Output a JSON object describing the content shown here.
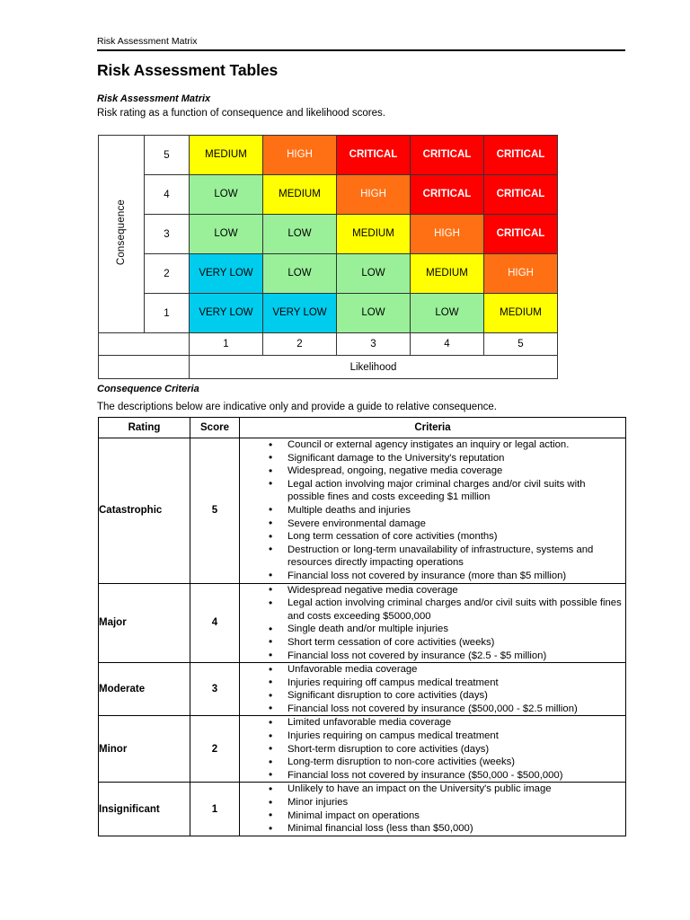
{
  "header": {
    "running_title": "Risk Assessment Matrix"
  },
  "page_title": "Risk Assessment Tables",
  "matrix_section": {
    "heading": "Risk Assessment Matrix",
    "subtitle": "Risk rating as a function of consequence and likelihood scores.",
    "axis_y_label": "Consequence",
    "axis_x_label": "Likelihood",
    "consequence_scores": [
      "5",
      "4",
      "3",
      "2",
      "1"
    ],
    "likelihood_scores": [
      "1",
      "2",
      "3",
      "4",
      "5"
    ],
    "colors": {
      "very_low": "#00CCEE",
      "low": "#99F099",
      "medium": "#FFFF00",
      "high": "#FF7014",
      "critical": "#FF0000",
      "white_text": "#FFFFFF",
      "black_text": "#000000"
    },
    "rows": [
      {
        "consequence": "5",
        "cells": [
          {
            "label": "MEDIUM",
            "level": "medium"
          },
          {
            "label": "HIGH",
            "level": "high"
          },
          {
            "label": "CRITICAL",
            "level": "critical"
          },
          {
            "label": "CRITICAL",
            "level": "critical"
          },
          {
            "label": "CRITICAL",
            "level": "critical"
          }
        ]
      },
      {
        "consequence": "4",
        "cells": [
          {
            "label": "LOW",
            "level": "low"
          },
          {
            "label": "MEDIUM",
            "level": "medium"
          },
          {
            "label": "HIGH",
            "level": "high"
          },
          {
            "label": "CRITICAL",
            "level": "critical"
          },
          {
            "label": "CRITICAL",
            "level": "critical"
          }
        ]
      },
      {
        "consequence": "3",
        "cells": [
          {
            "label": "LOW",
            "level": "low"
          },
          {
            "label": "LOW",
            "level": "low"
          },
          {
            "label": "MEDIUM",
            "level": "medium"
          },
          {
            "label": "HIGH",
            "level": "high"
          },
          {
            "label": "CRITICAL",
            "level": "critical"
          }
        ]
      },
      {
        "consequence": "2",
        "cells": [
          {
            "label": "VERY LOW",
            "level": "verylow"
          },
          {
            "label": "LOW",
            "level": "low"
          },
          {
            "label": "LOW",
            "level": "low"
          },
          {
            "label": "MEDIUM",
            "level": "medium"
          },
          {
            "label": "HIGH",
            "level": "high"
          }
        ]
      },
      {
        "consequence": "1",
        "cells": [
          {
            "label": "VERY LOW",
            "level": "verylow"
          },
          {
            "label": "VERY LOW",
            "level": "verylow"
          },
          {
            "label": "LOW",
            "level": "low"
          },
          {
            "label": "LOW",
            "level": "low"
          },
          {
            "label": "MEDIUM",
            "level": "medium"
          }
        ]
      }
    ]
  },
  "criteria_section": {
    "heading": "Consequence Criteria",
    "subtitle": "The descriptions below are indicative only and provide a guide to relative consequence.",
    "columns": [
      "Rating",
      "Score",
      "Criteria"
    ],
    "rows": [
      {
        "rating": "Catastrophic",
        "score": "5",
        "criteria": [
          "Council or external agency instigates an inquiry or legal action.",
          "Significant damage to the University's reputation",
          "Widespread, ongoing, negative media coverage",
          "Legal action involving major criminal charges and/or civil suits with possible fines and costs exceeding $1 million",
          "Multiple deaths and injuries",
          "Severe environmental damage",
          "Long term cessation of core activities (months)",
          "Destruction or long-term unavailability of infrastructure, systems and resources directly impacting operations",
          "Financial loss not covered by insurance  (more than $5 million)"
        ]
      },
      {
        "rating": "Major",
        "score": "4",
        "criteria": [
          "Widespread negative media coverage",
          "Legal action involving criminal charges and/or civil suits with possible fines and costs exceeding $5000,000",
          "Single death and/or multiple injuries",
          "Short term cessation of core activities (weeks)",
          "Financial loss not covered by insurance ($2.5 - $5 million)"
        ]
      },
      {
        "rating": "Moderate",
        "score": "3",
        "criteria": [
          "Unfavorable media coverage",
          "Injuries requiring off campus medical treatment",
          "Significant disruption to core activities (days)",
          "Financial loss not covered by insurance ($500,000 - $2.5 million)"
        ]
      },
      {
        "rating": "Minor",
        "score": "2",
        "criteria": [
          "Limited unfavorable media coverage",
          "Injuries requiring on campus medical treatment",
          "Short-term disruption to core activities (days)",
          "Long-term disruption to non-core activities (weeks)",
          "Financial loss not covered by insurance ($50,000 - $500,000)"
        ]
      },
      {
        "rating": "Insignificant",
        "score": "1",
        "criteria": [
          "Unlikely to have an impact on the University's public image",
          "Minor injuries",
          "Minimal impact on operations",
          "Minimal financial loss (less than $50,000)"
        ]
      }
    ]
  }
}
